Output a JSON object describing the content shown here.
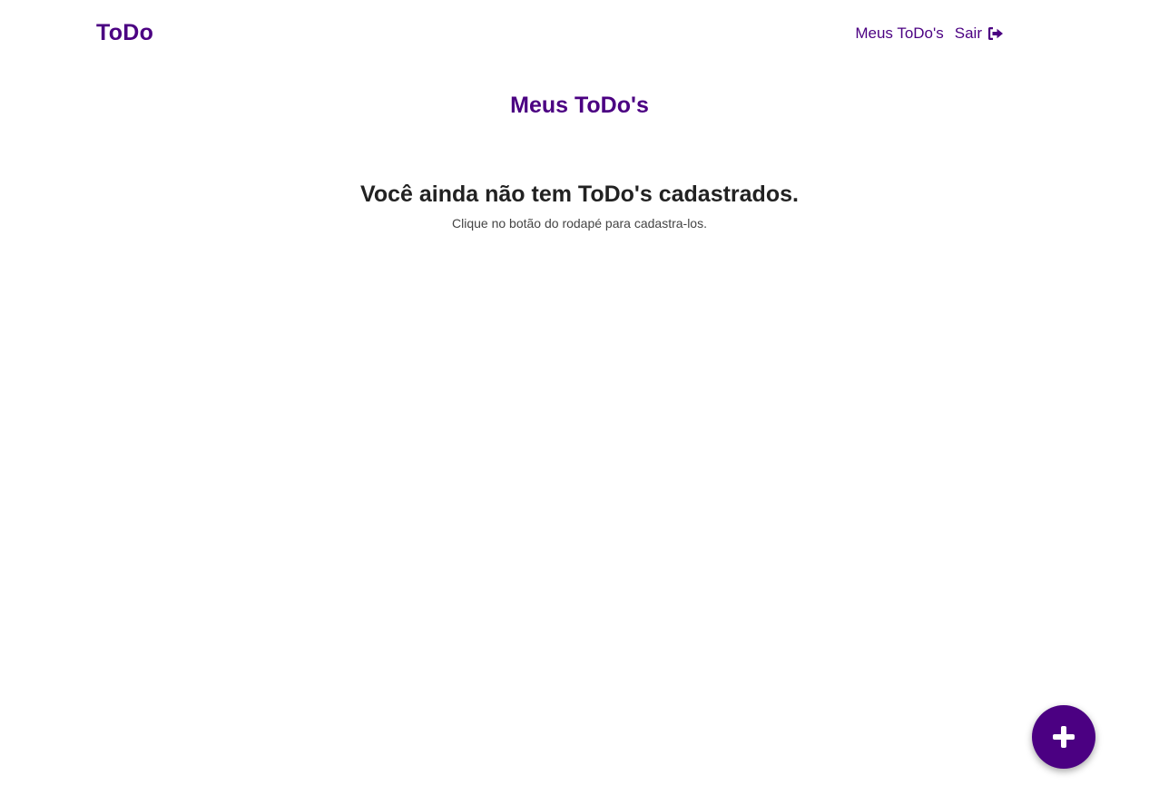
{
  "navbar": {
    "brand": "ToDo",
    "links": [
      {
        "label": "Meus ToDo's",
        "icon": null
      },
      {
        "label": "Sair",
        "icon": "sign-out-icon"
      }
    ]
  },
  "page": {
    "title": "Meus ToDo's"
  },
  "empty_state": {
    "heading": "Você ainda não tem ToDo's cadastrados.",
    "subtext": "Clique no botão do rodapé para cadastra-los."
  },
  "fab": {
    "icon": "plus-icon"
  },
  "colors": {
    "accent": "#4b0082",
    "text": "#222222",
    "background": "#ffffff"
  }
}
